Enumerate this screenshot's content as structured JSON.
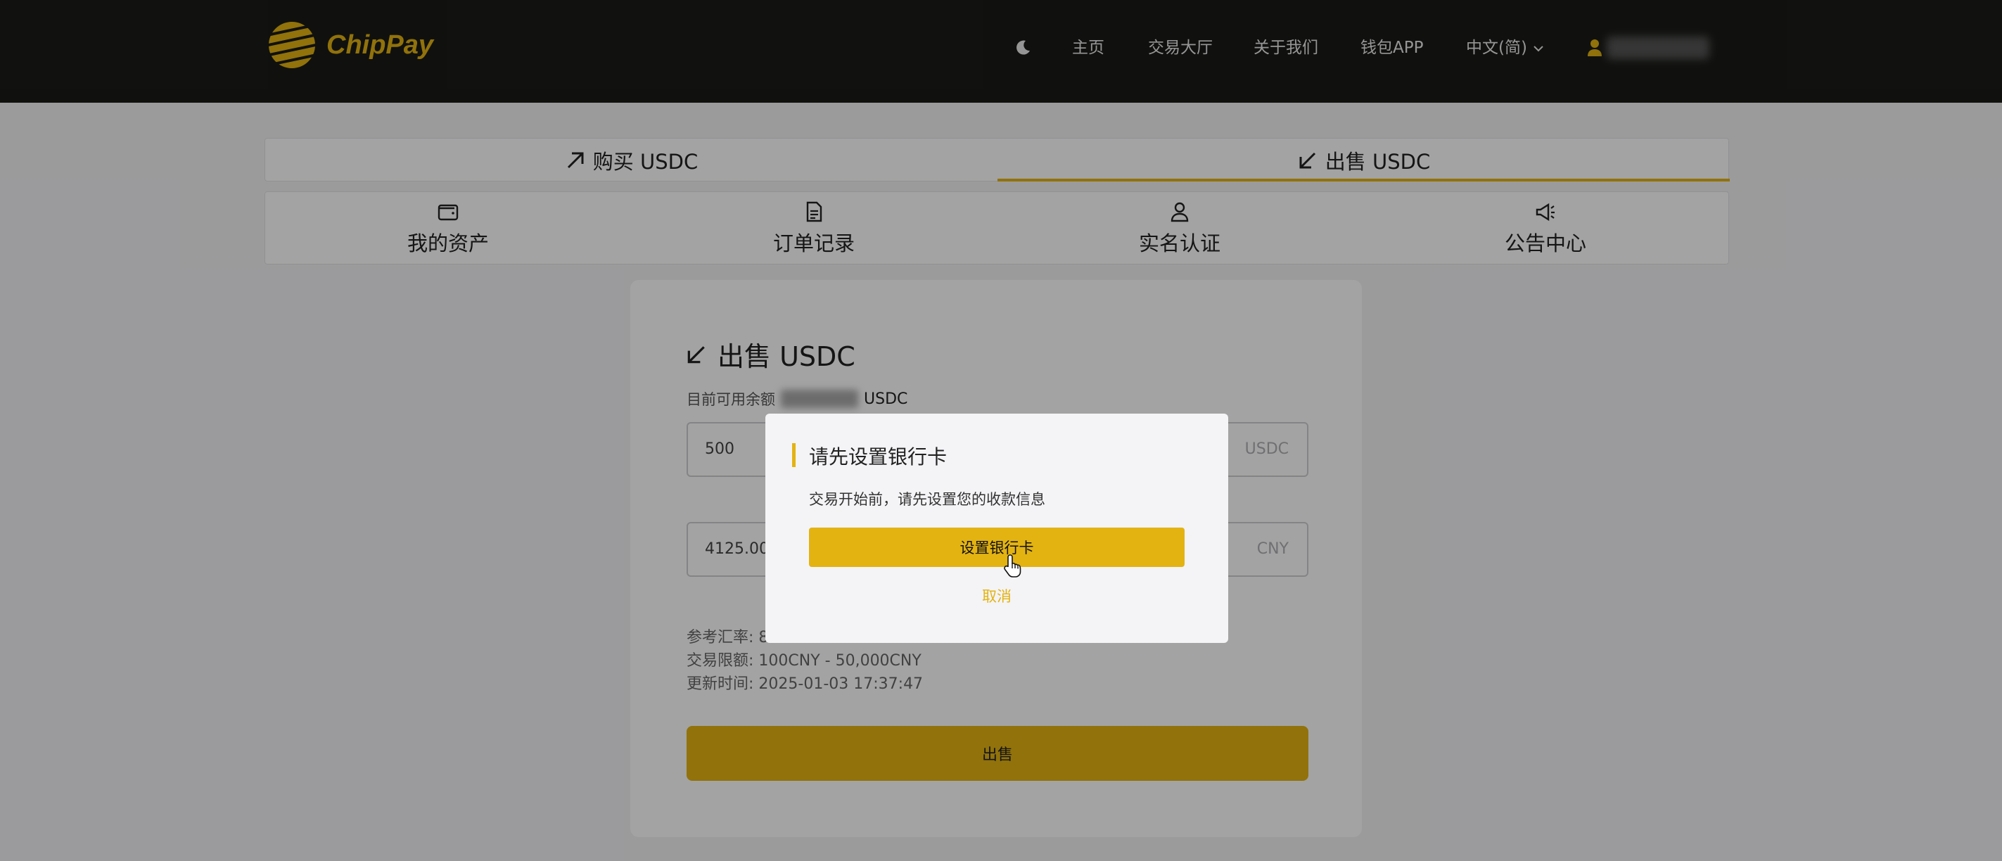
{
  "header": {
    "brand": "ChipPay",
    "nav": [
      {
        "label": "主页"
      },
      {
        "label": "交易大厅"
      },
      {
        "label": "关于我们"
      },
      {
        "label": "钱包APP"
      }
    ],
    "language": "中文(简)"
  },
  "tabs": [
    {
      "label": "购买 USDC",
      "icon": "arrow-up-right-icon"
    },
    {
      "label": "出售 USDC",
      "icon": "arrow-down-left-icon",
      "active": true
    }
  ],
  "subnav": [
    {
      "label": "我的资产",
      "icon": "wallet-icon"
    },
    {
      "label": "订单记录",
      "icon": "document-icon"
    },
    {
      "label": "实名认证",
      "icon": "user-icon"
    },
    {
      "label": "公告中心",
      "icon": "megaphone-icon"
    }
  ],
  "sell_form": {
    "title": "出售 USDC",
    "balance_label": "目前可用余额",
    "balance_unit": "USDC",
    "amount_value": "500",
    "amount_unit": "USDC",
    "cny_value": "4125.00",
    "cny_unit": "CNY",
    "rate_label": "参考汇率: 8",
    "limit_label": "交易限额: 100CNY - 50,000CNY",
    "update_time": "更新时间: 2025-01-03 17:37:47",
    "sell_button": "出售"
  },
  "modal": {
    "title": "请先设置银行卡",
    "message": "交易开始前，请先设置您的收款信息",
    "primary_button": "设置银行卡",
    "cancel_button": "取消"
  },
  "colors": {
    "accent": "#e3b312",
    "header_bg": "#1a1b17"
  }
}
